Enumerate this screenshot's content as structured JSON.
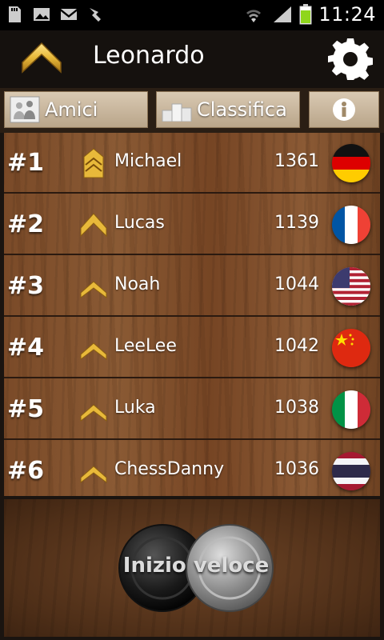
{
  "status_bar": {
    "time": "11:24",
    "icons": [
      "sd-card-icon",
      "image-icon",
      "gmail-icon",
      "sync-icon",
      "wifi-icon",
      "signal-icon",
      "battery-icon"
    ]
  },
  "header": {
    "player_name": "Leonardo",
    "rank_icon": "chevron-rank-icon",
    "settings_icon": "gear-icon"
  },
  "tabs": [
    {
      "label": "Amici",
      "icon": "friends-icon"
    },
    {
      "label": "Classifica",
      "icon": "podium-icon"
    },
    {
      "label": "",
      "icon": "info-icon"
    }
  ],
  "leaderboard": [
    {
      "rank": "#1",
      "name": "Michael",
      "score": "1361",
      "flag": "germany",
      "badge": "double-chevron"
    },
    {
      "rank": "#2",
      "name": "Lucas",
      "score": "1139",
      "flag": "france",
      "badge": "single-chevron"
    },
    {
      "rank": "#3",
      "name": "Noah",
      "score": "1044",
      "flag": "usa",
      "badge": "small-chevron"
    },
    {
      "rank": "#4",
      "name": "LeeLee",
      "score": "1042",
      "flag": "china",
      "badge": "small-chevron"
    },
    {
      "rank": "#5",
      "name": "Luka",
      "score": "1038",
      "flag": "italy",
      "badge": "small-chevron"
    },
    {
      "rank": "#6",
      "name": "ChessDanny",
      "score": "1036",
      "flag": "thailand",
      "badge": "small-chevron"
    }
  ],
  "quick_start": {
    "label": "Inizio veloce"
  },
  "colors": {
    "gold": "#e8b93a",
    "wood": "#7a4a28",
    "header_bg": "#15110e"
  }
}
